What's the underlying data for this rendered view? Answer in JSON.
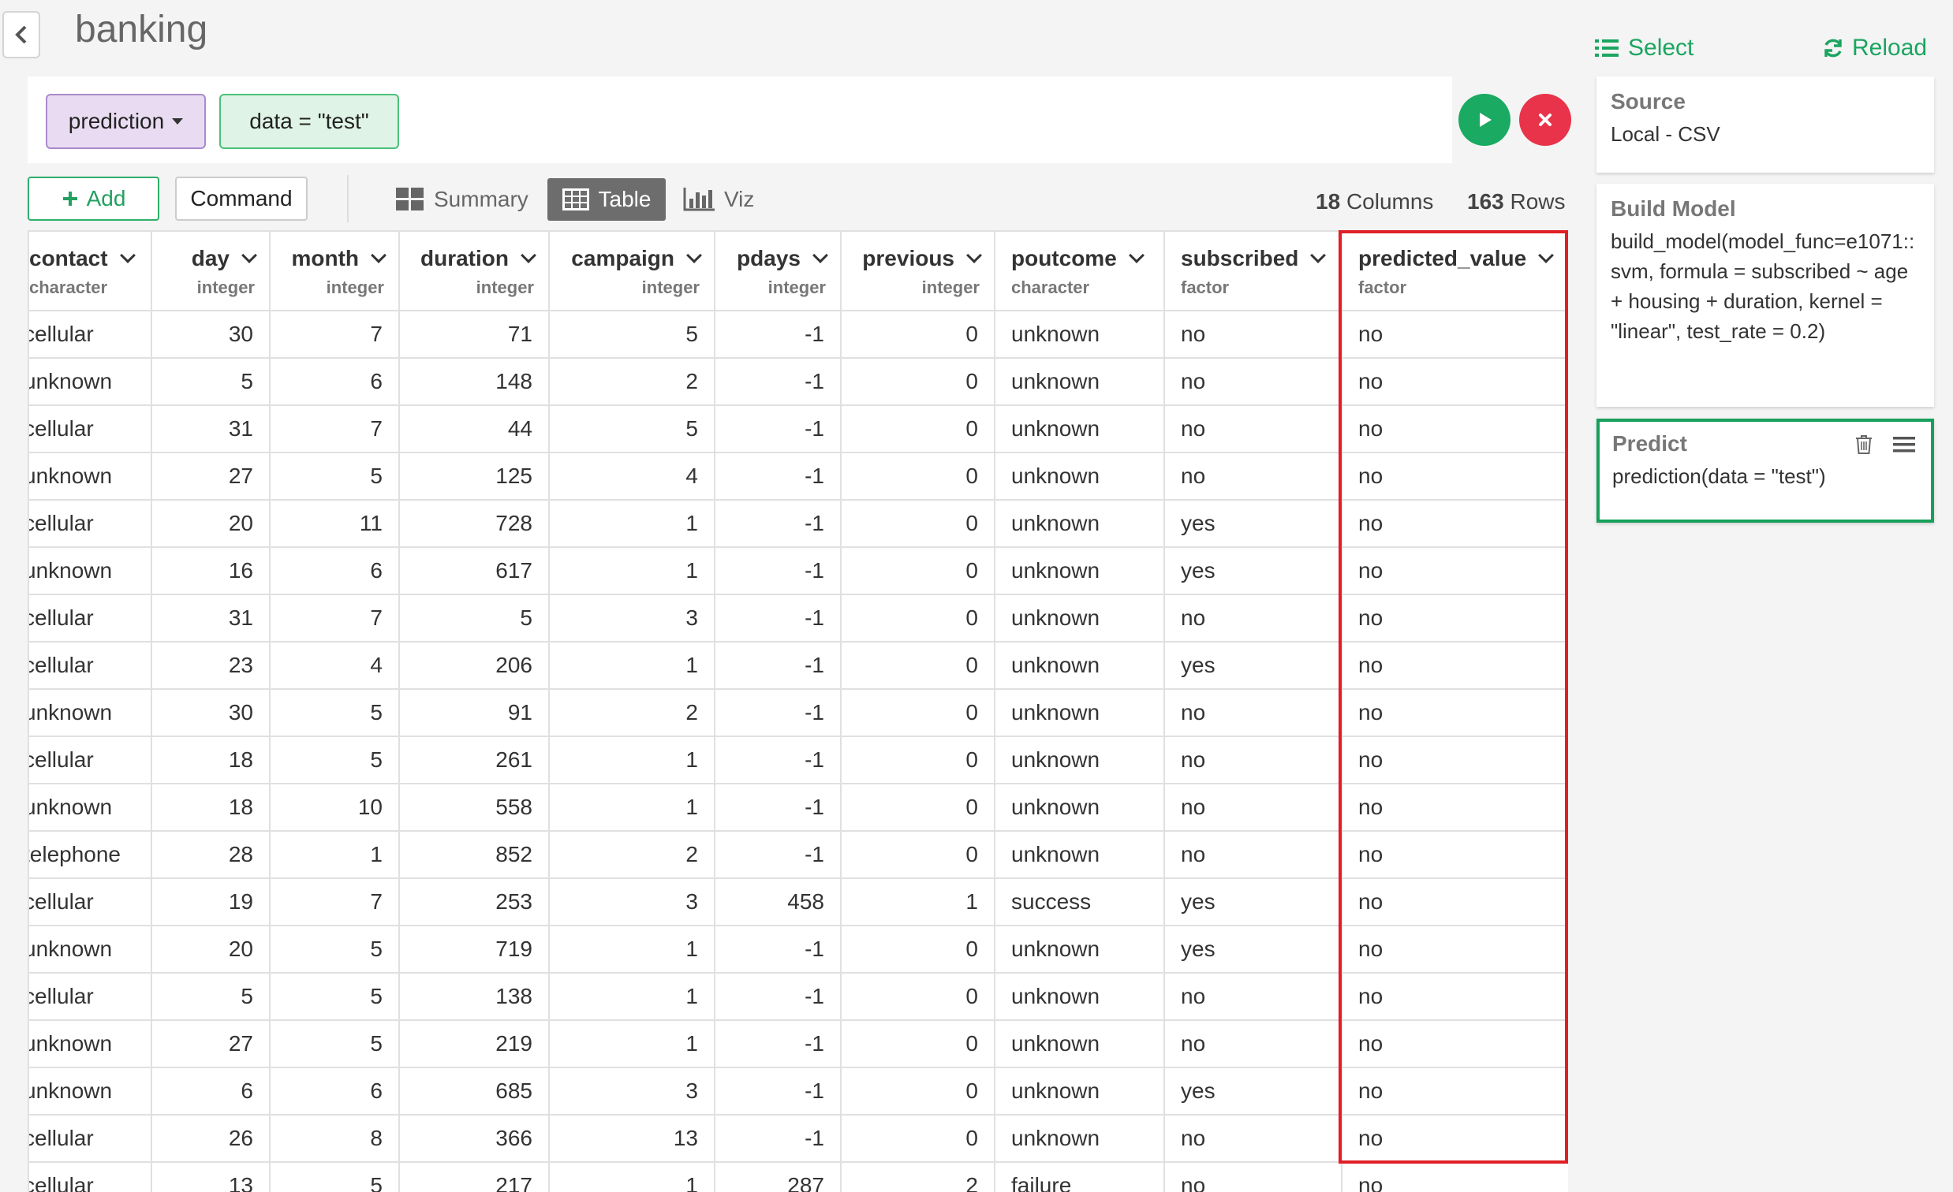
{
  "header": {
    "title": "banking"
  },
  "command": {
    "function_chip": "prediction",
    "arg_chip": "data = \"test\""
  },
  "toolbar": {
    "add_label": "Add",
    "command_label": "Command",
    "tabs": {
      "summary": "Summary",
      "table": "Table",
      "viz": "Viz"
    },
    "active_tab": "Table",
    "columns_count": "18",
    "columns_label": "Columns",
    "rows_count": "163",
    "rows_label": "Rows"
  },
  "table": {
    "columns": [
      {
        "name": "contact",
        "type": "character"
      },
      {
        "name": "day",
        "type": "integer"
      },
      {
        "name": "month",
        "type": "integer"
      },
      {
        "name": "duration",
        "type": "integer"
      },
      {
        "name": "campaign",
        "type": "integer"
      },
      {
        "name": "pdays",
        "type": "integer"
      },
      {
        "name": "previous",
        "type": "integer"
      },
      {
        "name": "poutcome",
        "type": "character"
      },
      {
        "name": "subscribed",
        "type": "factor"
      },
      {
        "name": "predicted_value",
        "type": "factor"
      }
    ],
    "rows": [
      [
        "cellular",
        "30",
        "7",
        "71",
        "5",
        "-1",
        "0",
        "unknown",
        "no",
        "no"
      ],
      [
        "unknown",
        "5",
        "6",
        "148",
        "2",
        "-1",
        "0",
        "unknown",
        "no",
        "no"
      ],
      [
        "cellular",
        "31",
        "7",
        "44",
        "5",
        "-1",
        "0",
        "unknown",
        "no",
        "no"
      ],
      [
        "unknown",
        "27",
        "5",
        "125",
        "4",
        "-1",
        "0",
        "unknown",
        "no",
        "no"
      ],
      [
        "cellular",
        "20",
        "11",
        "728",
        "1",
        "-1",
        "0",
        "unknown",
        "yes",
        "no"
      ],
      [
        "unknown",
        "16",
        "6",
        "617",
        "1",
        "-1",
        "0",
        "unknown",
        "yes",
        "no"
      ],
      [
        "cellular",
        "31",
        "7",
        "5",
        "3",
        "-1",
        "0",
        "unknown",
        "no",
        "no"
      ],
      [
        "cellular",
        "23",
        "4",
        "206",
        "1",
        "-1",
        "0",
        "unknown",
        "yes",
        "no"
      ],
      [
        "unknown",
        "30",
        "5",
        "91",
        "2",
        "-1",
        "0",
        "unknown",
        "no",
        "no"
      ],
      [
        "cellular",
        "18",
        "5",
        "261",
        "1",
        "-1",
        "0",
        "unknown",
        "no",
        "no"
      ],
      [
        "unknown",
        "18",
        "10",
        "558",
        "1",
        "-1",
        "0",
        "unknown",
        "no",
        "no"
      ],
      [
        "telephone",
        "28",
        "1",
        "852",
        "2",
        "-1",
        "0",
        "unknown",
        "no",
        "no"
      ],
      [
        "cellular",
        "19",
        "7",
        "253",
        "3",
        "458",
        "1",
        "success",
        "yes",
        "no"
      ],
      [
        "unknown",
        "20",
        "5",
        "719",
        "1",
        "-1",
        "0",
        "unknown",
        "yes",
        "no"
      ],
      [
        "cellular",
        "5",
        "5",
        "138",
        "1",
        "-1",
        "0",
        "unknown",
        "no",
        "no"
      ],
      [
        "unknown",
        "27",
        "5",
        "219",
        "1",
        "-1",
        "0",
        "unknown",
        "no",
        "no"
      ],
      [
        "unknown",
        "6",
        "6",
        "685",
        "3",
        "-1",
        "0",
        "unknown",
        "yes",
        "no"
      ],
      [
        "cellular",
        "26",
        "8",
        "366",
        "13",
        "-1",
        "0",
        "unknown",
        "no",
        "no"
      ],
      [
        "cellular",
        "13",
        "5",
        "217",
        "1",
        "287",
        "2",
        "failure",
        "no",
        "no"
      ]
    ]
  },
  "side": {
    "select_label": "Select",
    "reload_label": "Reload",
    "source": {
      "title": "Source",
      "body": "Local - CSV"
    },
    "build_model": {
      "title": "Build Model",
      "body": "build_model(model_func=e1071::svm, formula = subscribed ~ age + housing + duration, kernel = \"linear\", test_rate = 0.2)"
    },
    "predict": {
      "title": "Predict",
      "body": "prediction(data = \"test\")"
    }
  },
  "colors": {
    "accent_green": "#1aa560",
    "run_green": "#1aaa61",
    "cancel_red": "#e8334a",
    "highlight_red": "#e01f26",
    "chip_purple_bg": "#e9dcf2",
    "chip_green_bg": "#dff4e6"
  },
  "icons": [
    "chevron-left-icon",
    "caret-down-icon",
    "play-icon",
    "close-icon",
    "plus-icon",
    "summary-grid-icon",
    "table-icon",
    "bar-chart-icon",
    "list-icon",
    "refresh-icon",
    "trash-icon",
    "menu-icon",
    "column-chevron-icon"
  ]
}
